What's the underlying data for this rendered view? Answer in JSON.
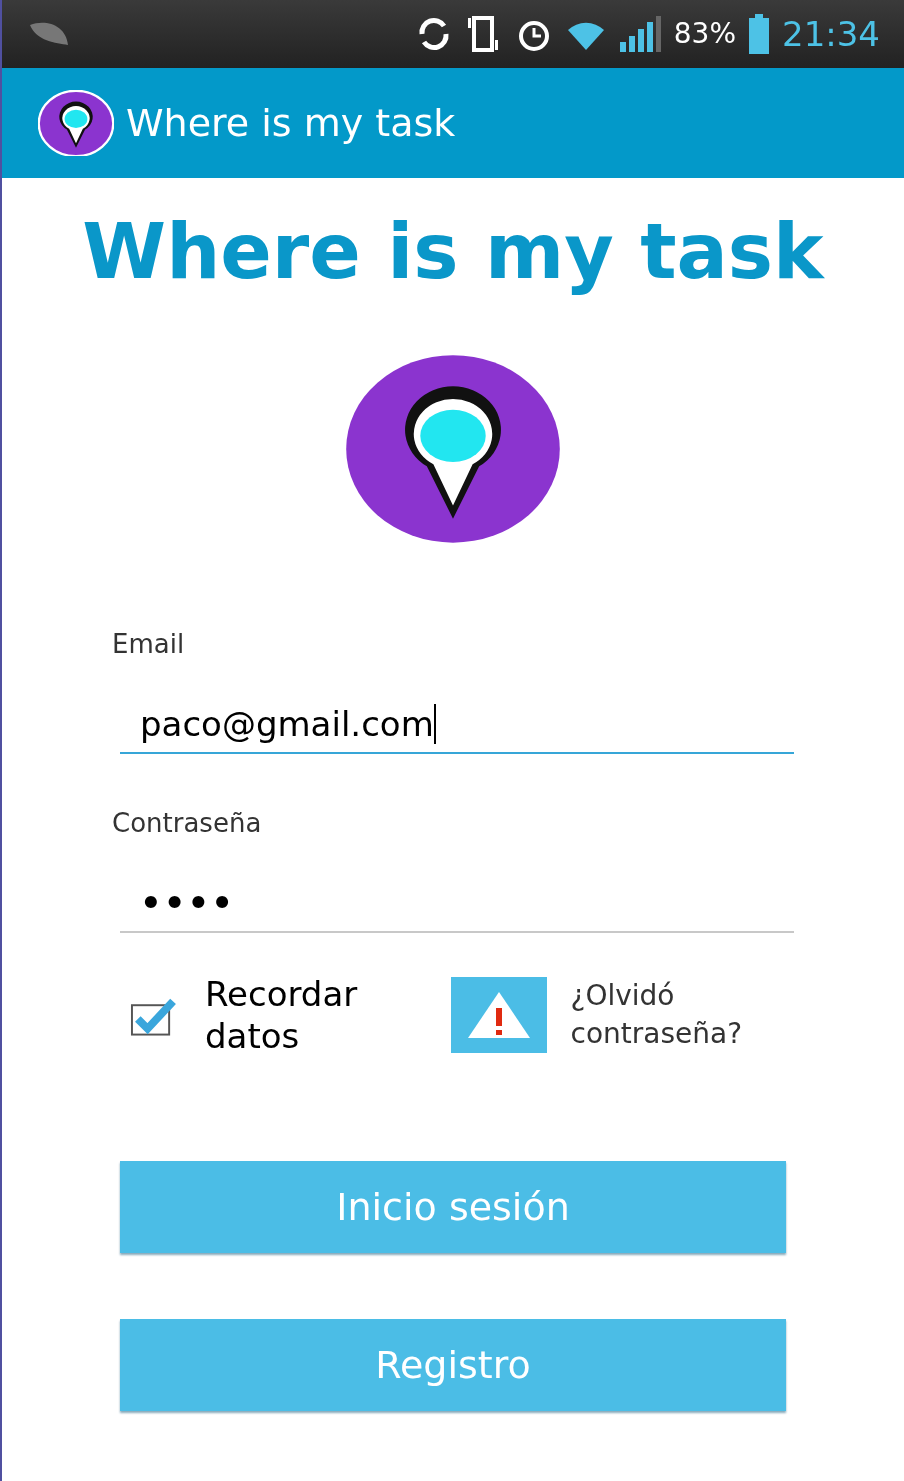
{
  "status_bar": {
    "battery": "83%",
    "time": "21:34"
  },
  "app_bar": {
    "title": "Where is my task"
  },
  "heading": "Where is my task",
  "fields": [
    {
      "label": "Email",
      "value": "paco@gmail.com",
      "focused": true,
      "kind": "text"
    },
    {
      "label": "Contraseña",
      "value": "••••",
      "focused": false,
      "kind": "password"
    }
  ],
  "remember": {
    "label": "Recordar datos",
    "checked": true
  },
  "forgot": {
    "label": "¿Olvidó contraseña?"
  },
  "buttons": [
    "Inicio sesión",
    "Registro"
  ]
}
